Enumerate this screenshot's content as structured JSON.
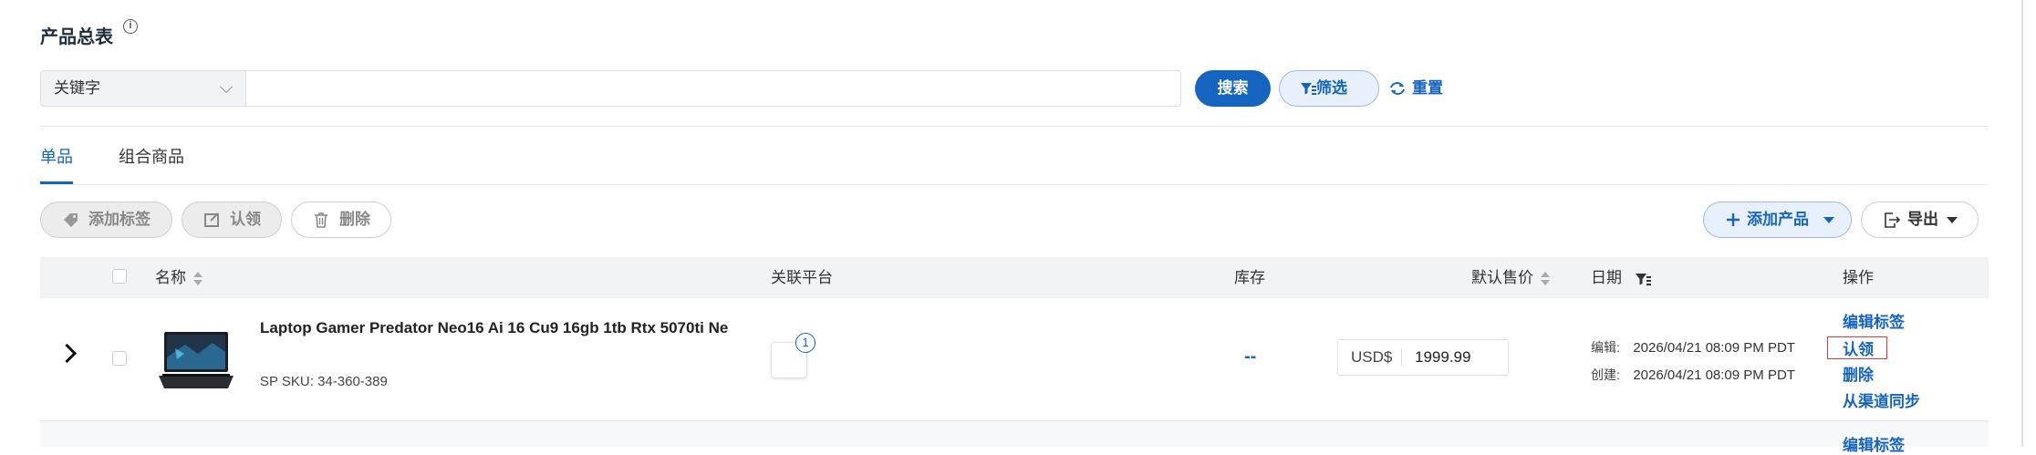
{
  "page": {
    "title": "产品总表",
    "info_icon": "info-icon"
  },
  "search": {
    "field_select": "关键字",
    "input_value": "",
    "search_label": "搜索",
    "filter_label": "筛选",
    "reset_label": "重置"
  },
  "tabs": [
    {
      "label": "单品",
      "active": true
    },
    {
      "label": "组合商品",
      "active": false
    }
  ],
  "toolbar": {
    "add_tag": "添加标签",
    "claim": "认领",
    "delete": "删除",
    "add_product": "添加产品",
    "export": "导出"
  },
  "table": {
    "columns": {
      "name": "名称",
      "platform": "关联平台",
      "stock": "库存",
      "price": "默认售价",
      "date": "日期",
      "actions": "操作"
    },
    "rows": [
      {
        "name": "Laptop Gamer Predator Neo16 Ai 16 Cu9 16gb 1tb Rtx 5070ti Ne",
        "sku": "SP SKU: 34-360-389",
        "platform_count": "1",
        "stock": "--",
        "price_currency": "USD$",
        "price_value": "1999.99",
        "edited_label": "编辑:",
        "edited_date": "2026/04/21 08:09 PM PDT",
        "created_label": "创建:",
        "created_date": "2026/04/21 08:09 PM PDT",
        "actions": [
          "编辑标签",
          "认领",
          "删除",
          "从渠道同步"
        ]
      }
    ],
    "next_row_action": "编辑标签"
  },
  "colors": {
    "primary": "#1565c0",
    "highlight_border": "#e53935"
  }
}
